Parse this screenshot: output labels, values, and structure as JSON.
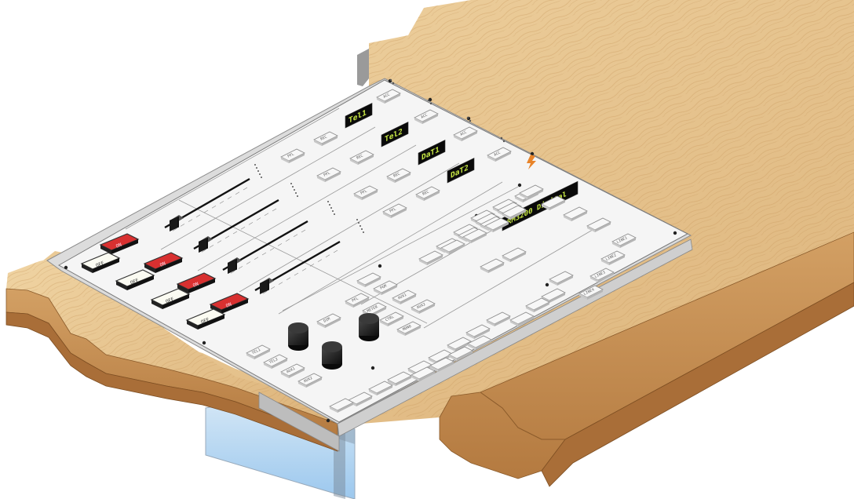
{
  "scene": {
    "colors": {
      "wood_top": "#e8c590",
      "wood_side": "#c79258",
      "wood_dark": "#a96e38",
      "panel": "#f5f5f5",
      "display_text": "#c8e845",
      "on_button": "#d83030",
      "tub_glass": "#b4d8f4"
    }
  },
  "channels": [
    {
      "display": "Tel1",
      "on": "ON",
      "off": "OFF",
      "pfl": "PFL",
      "rec": "REC",
      "acc": "ACC"
    },
    {
      "display": "Tel2",
      "on": "ON",
      "off": "OFF",
      "pfl": "PFL",
      "rec": "REC",
      "acc": "ACC"
    },
    {
      "display": "DaT1",
      "on": "ON",
      "off": "OFF",
      "pfl": "PFL",
      "rec": "REC",
      "acc": "ACC"
    },
    {
      "display": "DaT2",
      "on": "ON",
      "off": "OFF",
      "pfl": "PFL",
      "rec": "REC",
      "acc": "ACC"
    }
  ],
  "master": {
    "display": "RM3200 Digital",
    "monitor_keys": [
      "PFL",
      "METER",
      "CTRL",
      "MONO"
    ],
    "assign_keys": [
      "PGM",
      "AUX1",
      "AUX2"
    ],
    "monitor_mode_key": "DIM",
    "talkback_keys": [
      "TEL1",
      "TEL2",
      "AUX1",
      "AUX2"
    ],
    "right_column_keys": [
      "LINE1",
      "LINE2",
      "LINE3",
      "LINE4"
    ]
  }
}
